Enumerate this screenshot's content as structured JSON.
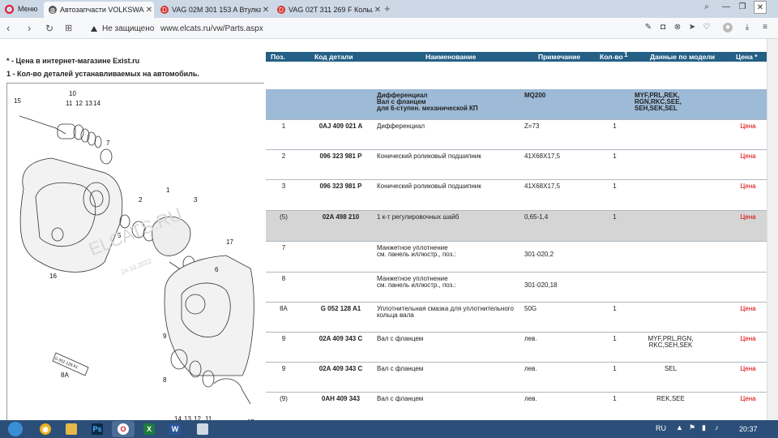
{
  "browser": {
    "menu_label": "Меню",
    "tabs": [
      {
        "title": "Автозапчасти VOLKSWAGEN",
        "active": true
      },
      {
        "title": "VAG 02M 301 153 A Втулка",
        "active": false
      },
      {
        "title": "VAG 02T 311 269 F Кольцо",
        "active": false
      }
    ],
    "secure_label": "Не защищено",
    "url": "www.elcats.ru/vw/Parts.aspx"
  },
  "notes": {
    "star_text": "* - Цена в интернет-магазине Exist.ru",
    "one_text": "1 - Кол-во деталей устанавливаемых на автомобиль."
  },
  "diagram": {
    "watermark": "ELCATS.RU",
    "date": "24.10.2022",
    "callouts": [
      "15",
      "10",
      "11",
      "12",
      "13",
      "14",
      "7",
      "2",
      "1",
      "3",
      "17",
      "6",
      "5",
      "16",
      "12",
      "8A",
      "9",
      "4",
      "13",
      "12",
      "11",
      "8",
      "G 052 128 A1",
      "15"
    ]
  },
  "table": {
    "headers": {
      "pos": "Поз.",
      "code": "Код детали",
      "name": "Наименование",
      "note": "Примечание",
      "qty": "Кол-во",
      "qty_sup": "1",
      "model": "Данные по модели",
      "price": "Цена *"
    },
    "group": {
      "name_line1": "Дифференциал",
      "name_line2": "Вал с фланцем",
      "name_line3": "для 6-ступен. механической КП",
      "note": "MQ200",
      "model_line1": "MYF,PRL,REK,",
      "model_line2": "RGN,RKC,SEE,",
      "model_line3": "SEH,SEK,SEL"
    },
    "rows": [
      {
        "pos": "1",
        "code": "0AJ 409 021 A",
        "name": "Дифференциал",
        "name2": "",
        "note": "Z=73",
        "qty": "1",
        "model": "",
        "model2": "",
        "price": "Цена"
      },
      {
        "pos": "2",
        "code": "096 323 981 P",
        "name": "Конический роликовый подшипник",
        "name2": "",
        "note": "41X68X17,5",
        "qty": "1",
        "model": "",
        "model2": "",
        "price": "Цена"
      },
      {
        "pos": "3",
        "code": "096 323 981 P",
        "name": "Конический роликовый подшипник",
        "name2": "",
        "note": "41X68X17,5",
        "qty": "1",
        "model": "",
        "model2": "",
        "price": "Цена"
      },
      {
        "pos": "(5)",
        "code": "02A 498 210",
        "name": "1 к-т регулировочных шайб",
        "name2": "",
        "note": "0,65-1,4",
        "qty": "1",
        "model": "",
        "model2": "",
        "price": "Цена"
      },
      {
        "pos": "7",
        "code": "",
        "name": "Манжетное уплотнение",
        "name2": "см. панель иллюстр., поз.:",
        "note": "301-020,2",
        "qty": "",
        "model": "",
        "model2": "",
        "price": ""
      },
      {
        "pos": "8",
        "code": "",
        "name": "Манжетное уплотнение",
        "name2": "см. панель иллюстр., поз.:",
        "note": "301-020,18",
        "qty": "",
        "model": "",
        "model2": "",
        "price": ""
      },
      {
        "pos": "8A",
        "code": "G 052 128 A1",
        "name": "Уплотнительная смазка для уплотнительного",
        "name2": "кольца вала",
        "note": "50G",
        "qty": "1",
        "model": "",
        "model2": "",
        "price": "Цена"
      },
      {
        "pos": "9",
        "code": "02A 409 343 C",
        "name": "Вал с фланцем",
        "name2": "",
        "note": "лев.",
        "qty": "1",
        "model": "MYF,PRL,RGN,",
        "model2": "RKC,SEH,SEK",
        "price": "Цена"
      },
      {
        "pos": "9",
        "code": "02A 409 343 C",
        "name": "Вал с фланцем",
        "name2": "",
        "note": "лев.",
        "qty": "1",
        "model": "SEL",
        "model2": "",
        "price": "Цена"
      },
      {
        "pos": "(9)",
        "code": "0AH 409 343",
        "name": "Вал с фланцем",
        "name2": "",
        "note": "лев.",
        "qty": "1",
        "model": "REK,SEE",
        "model2": "",
        "price": "Цена"
      }
    ]
  },
  "taskbar": {
    "lang": "RU",
    "time": "20:37"
  },
  "colors": {
    "header_bg": "#245f86",
    "group_bg": "#9dbad6",
    "selected_row_bg": "#d5d5d5",
    "price_red": "#d80000"
  }
}
